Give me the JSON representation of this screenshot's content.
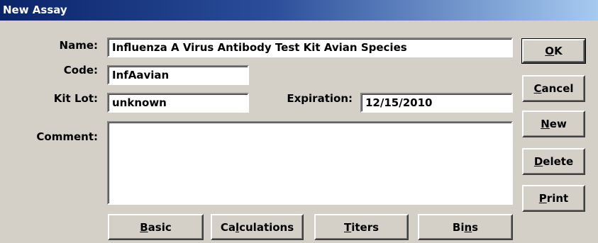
{
  "window": {
    "title": "New Assay"
  },
  "form": {
    "name_label": "Name:",
    "name_value": "Influenza A Virus Antibody Test Kit Avian Species",
    "code_label": "Code:",
    "code_value": "InfAavian",
    "kitlot_label": "Kit Lot:",
    "kitlot_value": "unknown",
    "expiration_label": "Expiration:",
    "expiration_value": "12/15/2010",
    "comment_label": "Comment:",
    "comment_value": ""
  },
  "side_buttons": [
    {
      "pre": "",
      "key": "O",
      "post": "K"
    },
    {
      "pre": "",
      "key": "C",
      "post": "ancel"
    },
    {
      "pre": "",
      "key": "N",
      "post": "ew"
    },
    {
      "pre": "",
      "key": "D",
      "post": "elete"
    },
    {
      "pre": "",
      "key": "P",
      "post": "rint"
    }
  ],
  "tab_buttons": [
    {
      "pre": "",
      "key": "B",
      "post": "asic"
    },
    {
      "pre": "Ca",
      "key": "l",
      "post": "culations"
    },
    {
      "pre": "",
      "key": "T",
      "post": "iters"
    },
    {
      "pre": "Bi",
      "key": "n",
      "post": "s"
    }
  ]
}
